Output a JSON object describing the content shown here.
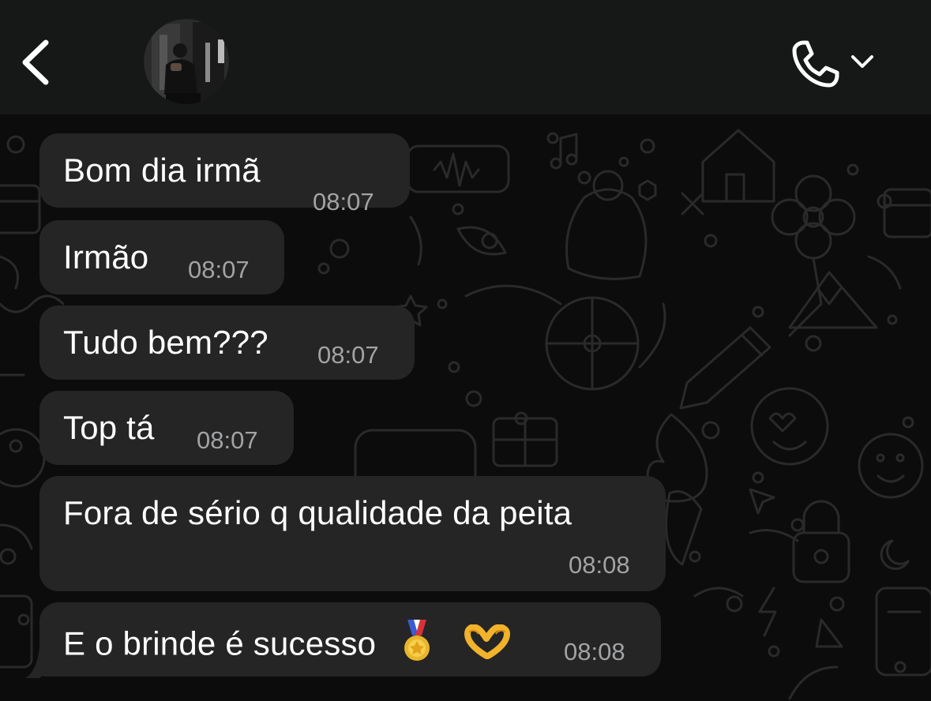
{
  "header": {
    "back_icon": "chevron-left-icon",
    "call_icon": "phone-icon",
    "call_menu_icon": "chevron-down-icon"
  },
  "colors": {
    "header_bg": "#161717",
    "chat_bg": "#0c0c0c",
    "bubble_bg": "#252526",
    "text": "#ffffff",
    "timestamp": "#a2a3a4"
  },
  "messages": [
    {
      "text": "Bom dia irmã",
      "time": "08:07"
    },
    {
      "text": "Irmão",
      "time": "08:07"
    },
    {
      "text": "Tudo bem???",
      "time": "08:07"
    },
    {
      "text": "Top tá",
      "time": "08:07"
    },
    {
      "text": "Fora de sério q qualidade da peita",
      "time": "08:08"
    },
    {
      "text": "E o brinde é sucesso",
      "time": "08:08",
      "emojis": [
        "medal-emoji",
        "heart-hands-emoji"
      ]
    }
  ]
}
